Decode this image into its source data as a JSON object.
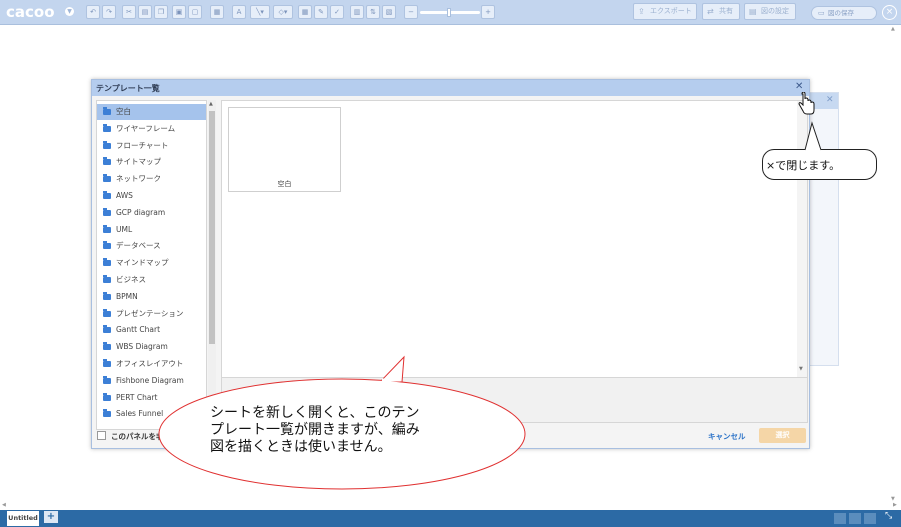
{
  "app": {
    "logo": "cacoo"
  },
  "toolbar": {
    "export_label": "エクスポート",
    "share_label": "共有",
    "diagram_settings_label": "図の設定",
    "save_label": "図の保存"
  },
  "dialog": {
    "title": "テンプレート一覧",
    "categories": [
      "空白",
      "ワイヤーフレーム",
      "フローチャート",
      "サイトマップ",
      "ネットワーク",
      "AWS",
      "GCP diagram",
      "UML",
      "データベース",
      "マインドマップ",
      "ビジネス",
      "BPMN",
      "プレゼンテーション",
      "Gantt Chart",
      "WBS Diagram",
      "オフィスレイアウト",
      "Fishbone Diagram",
      "PERT Chart",
      "Sales Funnel"
    ],
    "selected_category": "空白",
    "templates": [
      "空白"
    ],
    "hide_panel_label": "このパネルを非",
    "cancel_label": "キャンセル",
    "select_label": "選択"
  },
  "annotations": {
    "close_hint": "×で閉じます。",
    "note_lines": [
      "シートを新しく開くと、このテン",
      "プレート一覧が開きますが、編み",
      "図を描くときは使いません。"
    ]
  },
  "bottom": {
    "sheet_tab": "Untitled",
    "add_sheet": "+"
  },
  "colors": {
    "toolbar_bg": "#c3d5ee",
    "dialog_header": "#b5cdee",
    "selected_item": "#a5c3ec",
    "folder_icon": "#3c7fd6",
    "select_button": "#f5d6a7",
    "link": "#2c73c8",
    "bottom_bar": "#2c6aa5",
    "callout_border": "#e03030"
  }
}
